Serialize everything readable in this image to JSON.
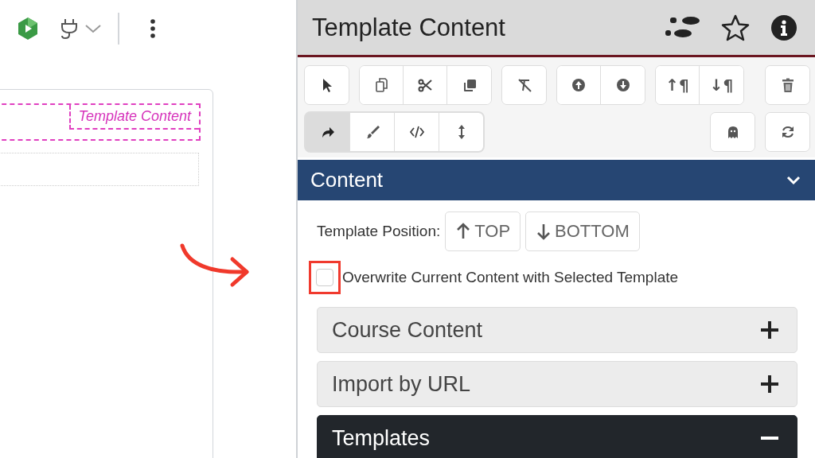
{
  "editor": {
    "template_label": "Template Content"
  },
  "panel": {
    "title": "Template Content",
    "toolbar": {
      "row1": [
        [
          {
            "kind": "pointer"
          }
        ],
        [
          {
            "kind": "copy"
          },
          {
            "kind": "cut"
          },
          {
            "kind": "clone"
          }
        ],
        [
          {
            "kind": "clear-format"
          }
        ],
        [
          {
            "kind": "up-circle"
          },
          {
            "kind": "down-circle"
          }
        ],
        [
          {
            "kind": "para",
            "label": "↑¶"
          },
          {
            "kind": "para",
            "label": "↓¶"
          }
        ],
        [
          {
            "kind": "trash"
          }
        ]
      ],
      "row2_modes": [
        {
          "kind": "redo",
          "selected": true
        },
        {
          "kind": "brush",
          "selected": false
        },
        {
          "kind": "code",
          "selected": false
        },
        {
          "kind": "resize",
          "selected": false
        }
      ],
      "row2_right": [
        {
          "kind": "ghost"
        },
        {
          "kind": "refresh"
        }
      ]
    },
    "section": {
      "title": "Content",
      "expanded": true
    },
    "template_position": {
      "label": "Template Position:",
      "buttons": [
        {
          "kind": "up",
          "label": "TOP"
        },
        {
          "kind": "down",
          "label": "BOTTOM"
        }
      ]
    },
    "overwrite": {
      "label": "Overwrite Current Content with Selected Template",
      "checked": false
    },
    "accordions": [
      {
        "title": "Course Content",
        "expanded": false
      },
      {
        "title": "Import by URL",
        "expanded": false
      },
      {
        "title": "Templates",
        "expanded": true
      }
    ]
  }
}
